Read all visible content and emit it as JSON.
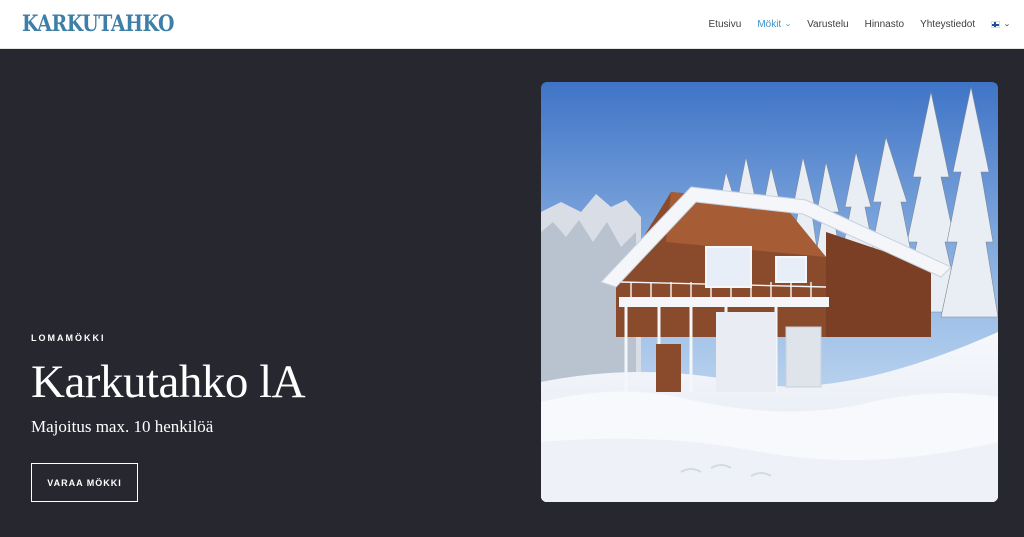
{
  "header": {
    "logo": "KARKUTAHKO",
    "nav": [
      {
        "label": "Etusivu",
        "active": false,
        "dropdown": false
      },
      {
        "label": "Mökit",
        "active": true,
        "dropdown": true
      },
      {
        "label": "Varustelu",
        "active": false,
        "dropdown": false
      },
      {
        "label": "Hinnasto",
        "active": false,
        "dropdown": false
      },
      {
        "label": "Yhteystiedot",
        "active": false,
        "dropdown": false
      }
    ],
    "language": {
      "icon": "finnish-flag-icon",
      "dropdown": true
    }
  },
  "hero": {
    "eyebrow": "LOMAMÖKKI",
    "title": "Karkutahko lA",
    "subtitle": "Majoitus max. 10 henkilöä",
    "cta_label": "VARAA MÖKKI",
    "image": {
      "subject": "winter-cabin-photo"
    }
  },
  "colors": {
    "brand": "#3e7fa8",
    "nav_active": "#3e90c7",
    "hero_background": "#272730",
    "text_light": "#ffffff"
  }
}
